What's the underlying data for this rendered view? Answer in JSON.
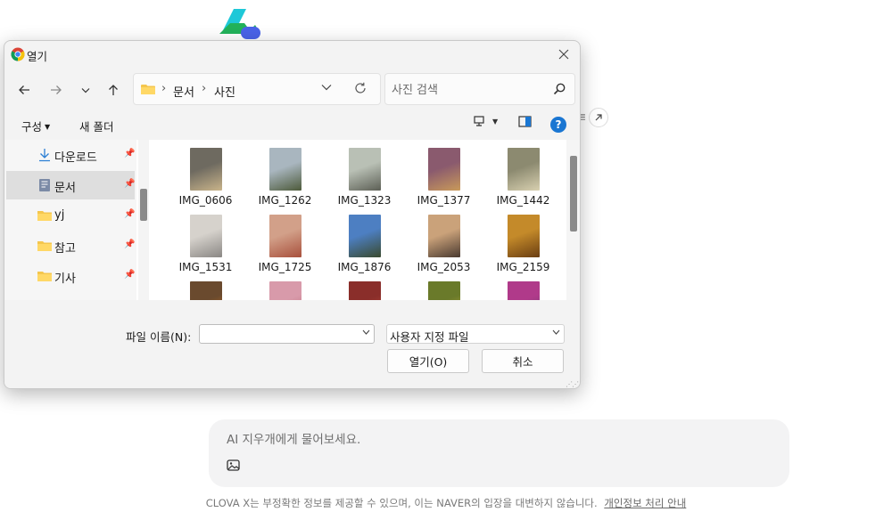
{
  "background": {
    "side_fragment": "ㅌ",
    "prompt": {
      "placeholder": "AI 지우개에게 물어보세요."
    },
    "footer": {
      "disclaimer": "CLOVA X는 부정확한 정보를 제공할 수 있으며, 이는 NAVER의 입장을 대변하지 않습니다.",
      "privacy_link": "개인정보 처리 안내"
    }
  },
  "dialog": {
    "title": "열기",
    "address": {
      "crumbs": [
        "문서",
        "사진"
      ]
    },
    "search": {
      "placeholder": "사진 검색"
    },
    "commands": {
      "organize": "구성",
      "new_folder": "새 폴더"
    },
    "help": "?",
    "nav_items": [
      {
        "label": "다운로드",
        "icon": "download-icon",
        "pinned": true
      },
      {
        "label": "문서",
        "icon": "document-folder-icon",
        "pinned": true,
        "selected": true
      },
      {
        "label": "yj",
        "icon": "folder-icon",
        "pinned": true
      },
      {
        "label": "참고",
        "icon": "folder-icon",
        "pinned": true
      },
      {
        "label": "기사",
        "icon": "folder-icon",
        "pinned": true
      }
    ],
    "files": [
      {
        "name": "IMG_0606",
        "colors": [
          "#6e6a60",
          "#c9b48a"
        ]
      },
      {
        "name": "IMG_1262",
        "colors": [
          "#a9b6bf",
          "#4d5a3a"
        ]
      },
      {
        "name": "IMG_1323",
        "colors": [
          "#b9c0b5",
          "#5c5f55"
        ]
      },
      {
        "name": "IMG_1377",
        "colors": [
          "#8a5a6e",
          "#c99a5a"
        ]
      },
      {
        "name": "IMG_1442",
        "colors": [
          "#8c8a70",
          "#d8d0b0"
        ]
      },
      {
        "name": "IMG_1531",
        "colors": [
          "#d6d2cc",
          "#8a8784"
        ]
      },
      {
        "name": "IMG_1725",
        "colors": [
          "#d2a089",
          "#a8503c"
        ]
      },
      {
        "name": "IMG_1876",
        "colors": [
          "#4d7fc2",
          "#3a4a2e"
        ]
      },
      {
        "name": "IMG_2053",
        "colors": [
          "#caa27a",
          "#4a3a30"
        ]
      },
      {
        "name": "IMG_2159",
        "colors": [
          "#c48a2a",
          "#6a3e12"
        ]
      },
      {
        "name": "",
        "colors": [
          "#6a4a2e",
          "#d2701e"
        ]
      },
      {
        "name": "",
        "colors": [
          "#d89aaa",
          "#b85a6a"
        ]
      },
      {
        "name": "",
        "colors": [
          "#8a2e2a",
          "#c44a3a"
        ]
      },
      {
        "name": "",
        "colors": [
          "#6a7a2a",
          "#c8b03a"
        ]
      },
      {
        "name": "",
        "colors": [
          "#b03a8a",
          "#5a3a6a"
        ]
      }
    ],
    "filename": {
      "label": "파일 이름(N):",
      "value": ""
    },
    "filetype": {
      "value": "사용자 지정 파일"
    },
    "open_button": "열기(O)",
    "cancel_button": "취소"
  }
}
